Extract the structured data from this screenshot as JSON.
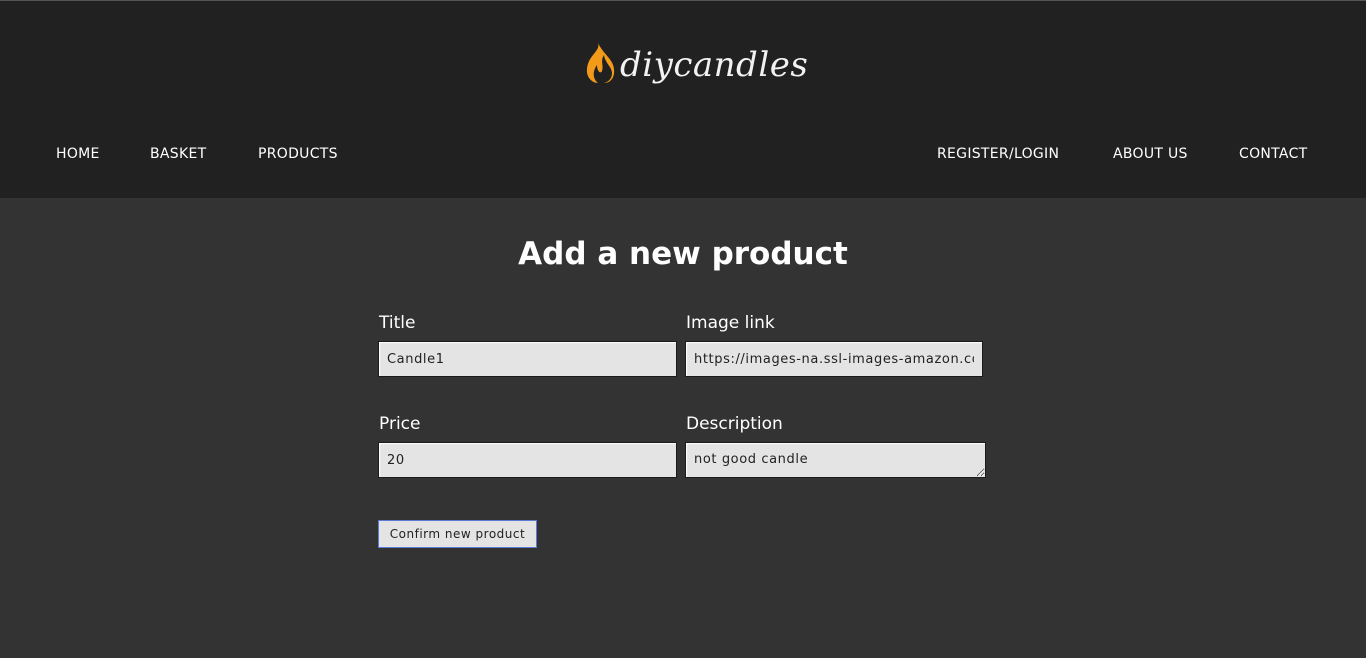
{
  "brand": {
    "name": "diycandles",
    "logo_icon": "flame-icon",
    "accent_color": "#f39a1b"
  },
  "nav": {
    "left": [
      "HOME",
      "BASKET",
      "PRODUCTS"
    ],
    "right": [
      "REGISTER/LOGIN",
      "ABOUT US",
      "CONTACT"
    ]
  },
  "form": {
    "title": "Add a new product",
    "fields": {
      "title": {
        "label": "Title",
        "value": "Candle1"
      },
      "image_link": {
        "label": "Image link",
        "value": "https://images-na.ssl-images-amazon.com"
      },
      "price": {
        "label": "Price",
        "value": "20"
      },
      "description": {
        "label": "Description",
        "value": "not good candle"
      }
    },
    "submit_label": "Confirm new product"
  }
}
